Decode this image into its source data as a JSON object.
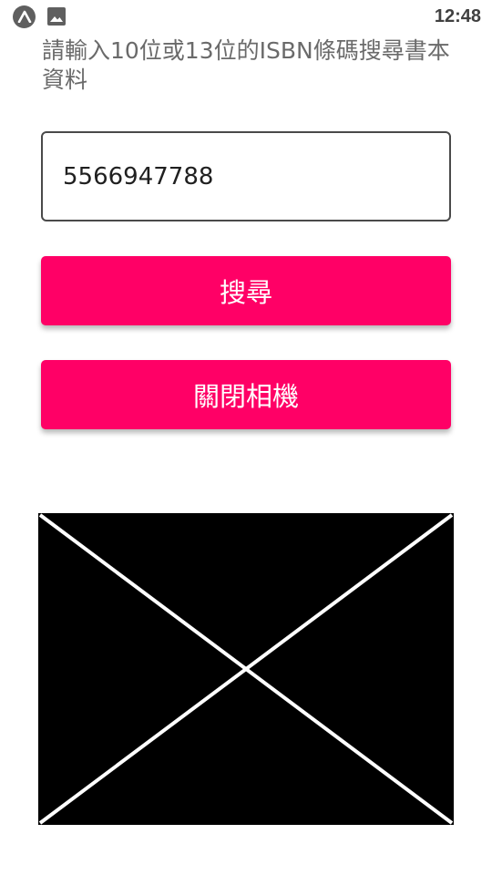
{
  "status_bar": {
    "time": "12:48",
    "icons": [
      "expo-app-icon",
      "gallery-icon"
    ]
  },
  "prompt": {
    "text": "請輸入10位或13位的ISBN條碼搜尋書本資料"
  },
  "isbn_field": {
    "value": "5566947788"
  },
  "buttons": {
    "search_label": "搜尋",
    "close_camera_label": "關閉相機"
  },
  "camera_view": {
    "icon": "broken-image-placeholder"
  },
  "colors": {
    "accent": "#ff0066",
    "prompt_text": "#6a6a6a",
    "camera_background": "#000000"
  }
}
